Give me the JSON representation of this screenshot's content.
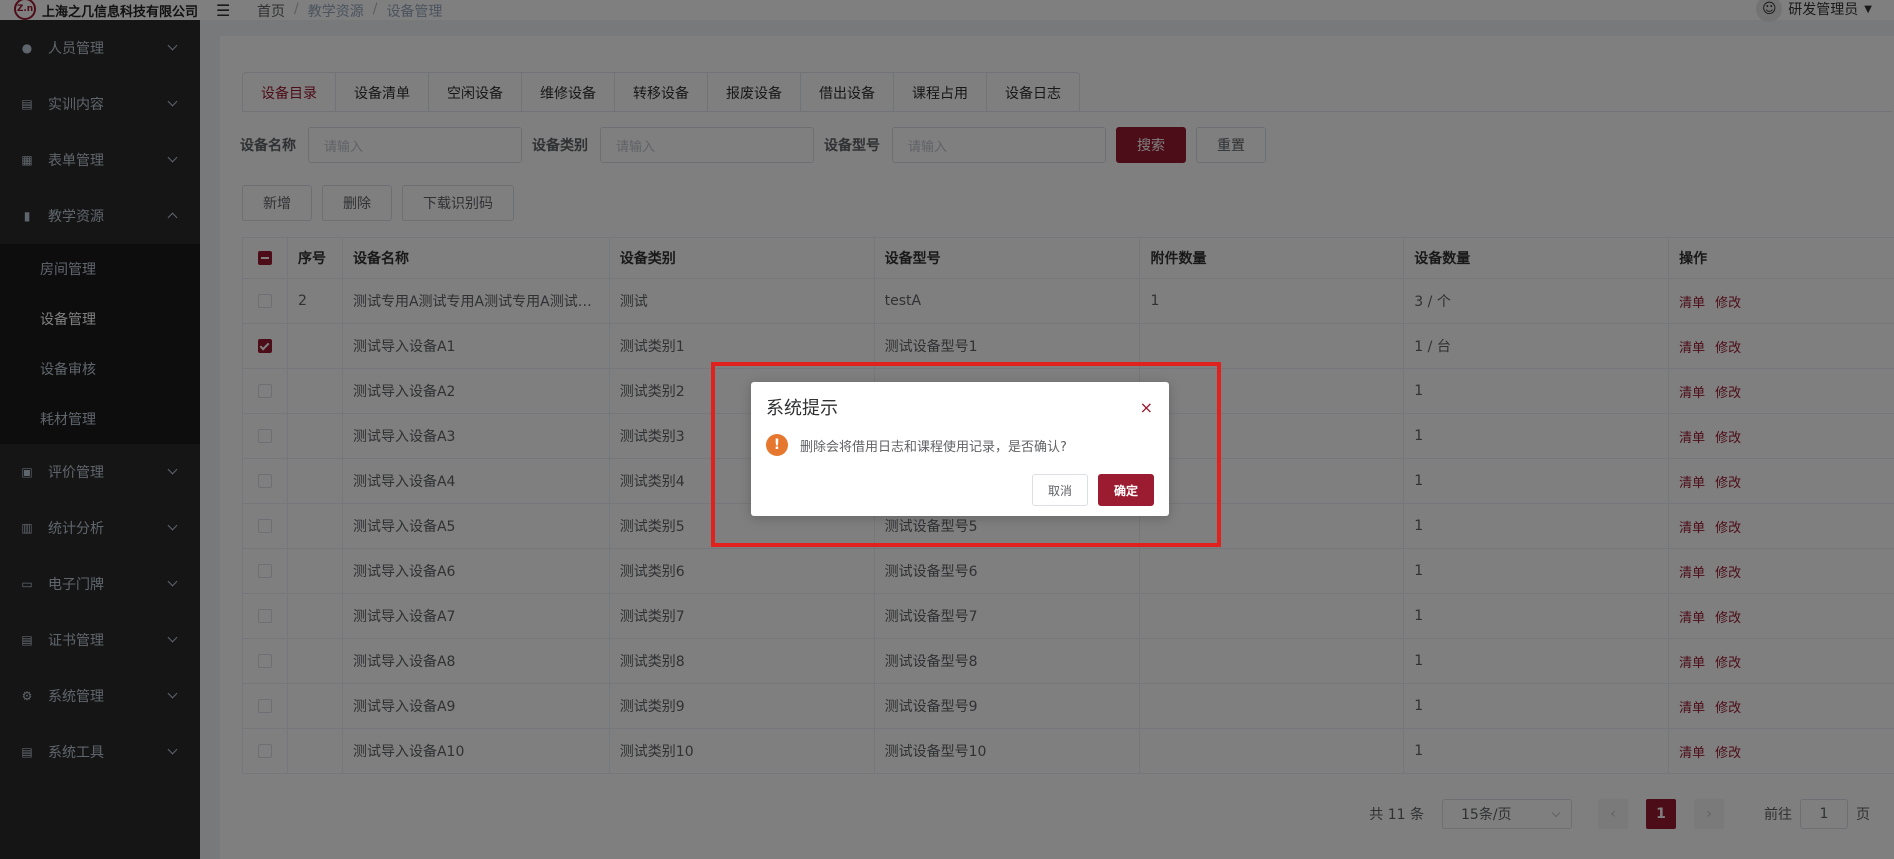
{
  "header": {
    "logo_badge": "Z.n",
    "company": "上海之几信息科技有限公司",
    "breadcrumb": [
      "首页",
      "教学资源",
      "设备管理"
    ],
    "breadcrumb_sep": "/",
    "user": "研发管理员"
  },
  "sidebar": {
    "items": [
      {
        "label": "人员管理",
        "icon": "user-icon"
      },
      {
        "label": "实训内容",
        "icon": "book-icon"
      },
      {
        "label": "表单管理",
        "icon": "form-icon"
      },
      {
        "label": "教学资源",
        "icon": "resource-icon"
      },
      {
        "label": "评价管理",
        "icon": "evaluation-icon"
      },
      {
        "label": "统计分析",
        "icon": "chart-icon"
      },
      {
        "label": "电子门牌",
        "icon": "monitor-icon"
      },
      {
        "label": "证书管理",
        "icon": "certificate-icon"
      },
      {
        "label": "系统管理",
        "icon": "gear-icon"
      },
      {
        "label": "系统工具",
        "icon": "toolbox-icon"
      }
    ],
    "submenu": [
      "房间管理",
      "设备管理",
      "设备审核",
      "耗材管理"
    ]
  },
  "tabs": [
    "设备目录",
    "设备清单",
    "空闲设备",
    "维修设备",
    "转移设备",
    "报废设备",
    "借出设备",
    "课程占用",
    "设备日志"
  ],
  "search": {
    "name_label": "设备名称",
    "type_label": "设备类别",
    "model_label": "设备型号",
    "placeholder": "请输入",
    "search_btn": "搜索",
    "reset_btn": "重置"
  },
  "actions": {
    "add": "新增",
    "delete": "删除",
    "download": "下载识别码"
  },
  "table": {
    "columns": [
      "序号",
      "设备名称",
      "设备类别",
      "设备型号",
      "附件数量",
      "设备数量",
      "操作"
    ],
    "rows": [
      {
        "checked": false,
        "idx": "2",
        "name": "测试专用A测试专用A测试专用A测试专用A",
        "type": "测试",
        "model": "testA",
        "attach": "1",
        "count": "3 / 个"
      },
      {
        "checked": true,
        "idx": "",
        "name": "测试导入设备A1",
        "type": "测试类别1",
        "model": "测试设备型号1",
        "attach": "",
        "count": "1 / 台"
      },
      {
        "checked": false,
        "idx": "",
        "name": "测试导入设备A2",
        "type": "测试类别2",
        "model": "",
        "attach": "",
        "count": "1"
      },
      {
        "checked": false,
        "idx": "",
        "name": "测试导入设备A3",
        "type": "测试类别3",
        "model": "",
        "attach": "",
        "count": "1"
      },
      {
        "checked": false,
        "idx": "",
        "name": "测试导入设备A4",
        "type": "测试类别4",
        "model": "",
        "attach": "",
        "count": "1"
      },
      {
        "checked": false,
        "idx": "",
        "name": "测试导入设备A5",
        "type": "测试类别5",
        "model": "测试设备型号5",
        "attach": "",
        "count": "1"
      },
      {
        "checked": false,
        "idx": "",
        "name": "测试导入设备A6",
        "type": "测试类别6",
        "model": "测试设备型号6",
        "attach": "",
        "count": "1"
      },
      {
        "checked": false,
        "idx": "",
        "name": "测试导入设备A7",
        "type": "测试类别7",
        "model": "测试设备型号7",
        "attach": "",
        "count": "1"
      },
      {
        "checked": false,
        "idx": "",
        "name": "测试导入设备A8",
        "type": "测试类别8",
        "model": "测试设备型号8",
        "attach": "",
        "count": "1"
      },
      {
        "checked": false,
        "idx": "",
        "name": "测试导入设备A9",
        "type": "测试类别9",
        "model": "测试设备型号9",
        "attach": "",
        "count": "1"
      },
      {
        "checked": false,
        "idx": "",
        "name": "测试导入设备A10",
        "type": "测试类别10",
        "model": "测试设备型号10",
        "attach": "",
        "count": "1"
      }
    ],
    "op_list": "清单",
    "op_edit": "修改"
  },
  "pagination": {
    "total": "共 11 条",
    "page_size": "15条/页",
    "current": "1",
    "goto_label": "前往",
    "goto_value": "1",
    "goto_suffix": "页",
    "prev": "‹",
    "next": "›"
  },
  "dialog": {
    "title": "系统提示",
    "message": "删除会将借用日志和课程使用记录，是否确认?",
    "cancel": "取消",
    "confirm": "确定",
    "close_glyph": "×",
    "warn_glyph": "!"
  },
  "colors": {
    "brand": "#9b1b30",
    "warning": "#e6772e",
    "highlight": "#e0211d"
  }
}
